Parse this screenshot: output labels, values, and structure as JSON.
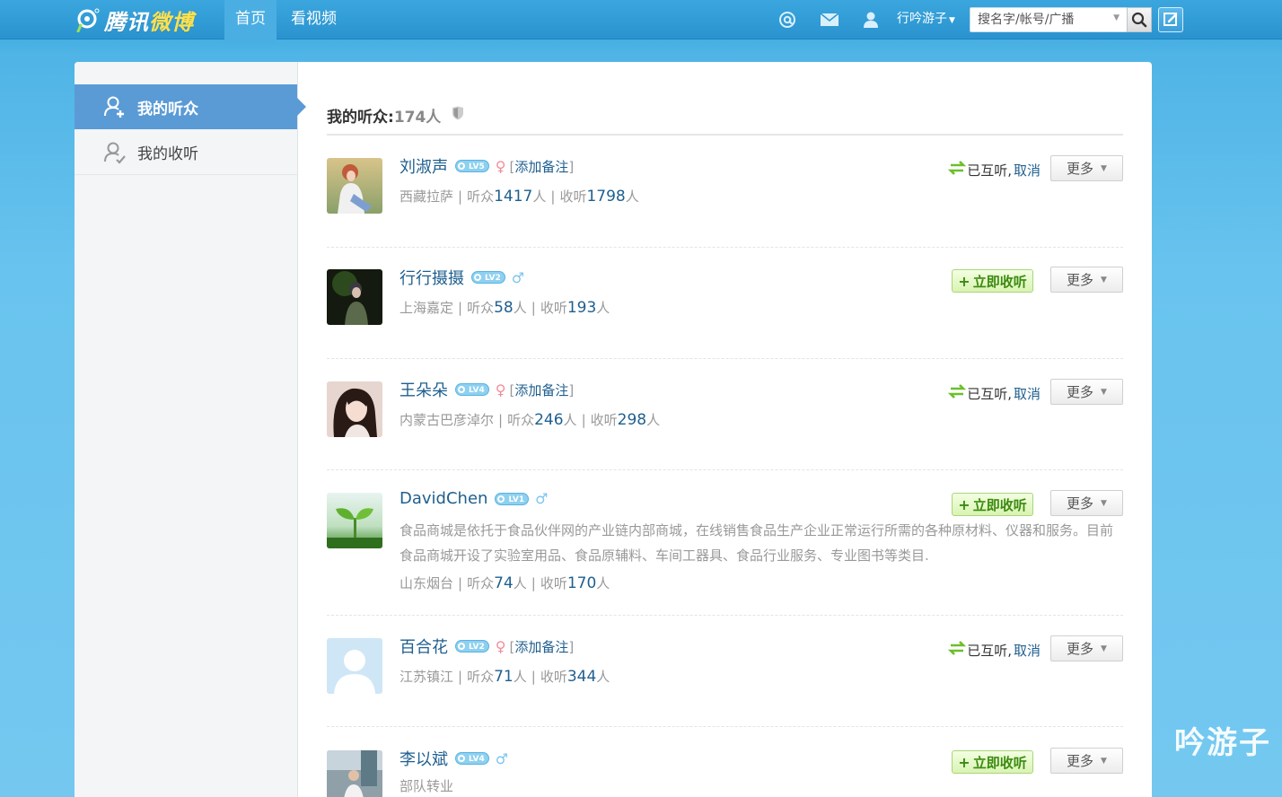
{
  "topbar": {
    "logo_text_a": "腾讯",
    "logo_text_b": "微博",
    "nav": [
      {
        "label": "首页",
        "active": true
      },
      {
        "label": "看视频",
        "active": false
      }
    ],
    "icons": [
      "at-icon",
      "mail-icon",
      "user-icon"
    ],
    "user_name": "行吟游子",
    "search_placeholder": "搜名字/帐号/广播"
  },
  "sidebar": {
    "items": [
      {
        "label": "我的听众",
        "active": true
      },
      {
        "label": "我的收听",
        "active": false
      }
    ]
  },
  "header": {
    "title": "我的听众:",
    "count": "174人"
  },
  "labels": {
    "add_note": "添加备注",
    "mutual": "已互听,",
    "cancel": "取消",
    "follow": "立即收听",
    "more": "更多",
    "fans_prefix": "听众",
    "follow_prefix": "收听",
    "unit": "人",
    "sep": "|"
  },
  "colors": {
    "accent": "#2a93cf",
    "link": "#1f5f8f",
    "sidebar_active": "#5a9bd6",
    "follow_green": "#3b8a10"
  },
  "users": [
    {
      "name": "刘淑声",
      "level": "LV5",
      "gender": "female",
      "note": true,
      "location": "西藏拉萨",
      "fans": "1417",
      "following": "1798",
      "mutual": true,
      "desc": ""
    },
    {
      "name": "行行摄摄",
      "level": "LV2",
      "gender": "male",
      "note": false,
      "location": "上海嘉定",
      "fans": "58",
      "following": "193",
      "mutual": false,
      "desc": ""
    },
    {
      "name": "王朵朵",
      "level": "LV4",
      "gender": "female",
      "note": true,
      "location": "内蒙古巴彦淖尔",
      "fans": "246",
      "following": "298",
      "mutual": true,
      "desc": ""
    },
    {
      "name": "DavidChen",
      "level": "LV1",
      "gender": "male",
      "note": false,
      "location": "山东烟台",
      "fans": "74",
      "following": "170",
      "mutual": false,
      "desc": "食品商城是依托于食品伙伴网的产业链内部商城，在线销售食品生产企业正常运行所需的各种原材料、仪器和服务。目前食品商城开设了实验室用品、食品原辅料、车间工器具、食品行业服务、专业图书等类目."
    },
    {
      "name": "百合花",
      "level": "LV2",
      "gender": "female",
      "note": true,
      "location": "江苏镇江",
      "fans": "71",
      "following": "344",
      "mutual": true,
      "desc": ""
    },
    {
      "name": "李以斌",
      "level": "LV4",
      "gender": "male",
      "note": false,
      "location": "部队转业",
      "fans": "",
      "following": "",
      "mutual": false,
      "desc": ""
    }
  ],
  "watermark": "吟游子"
}
